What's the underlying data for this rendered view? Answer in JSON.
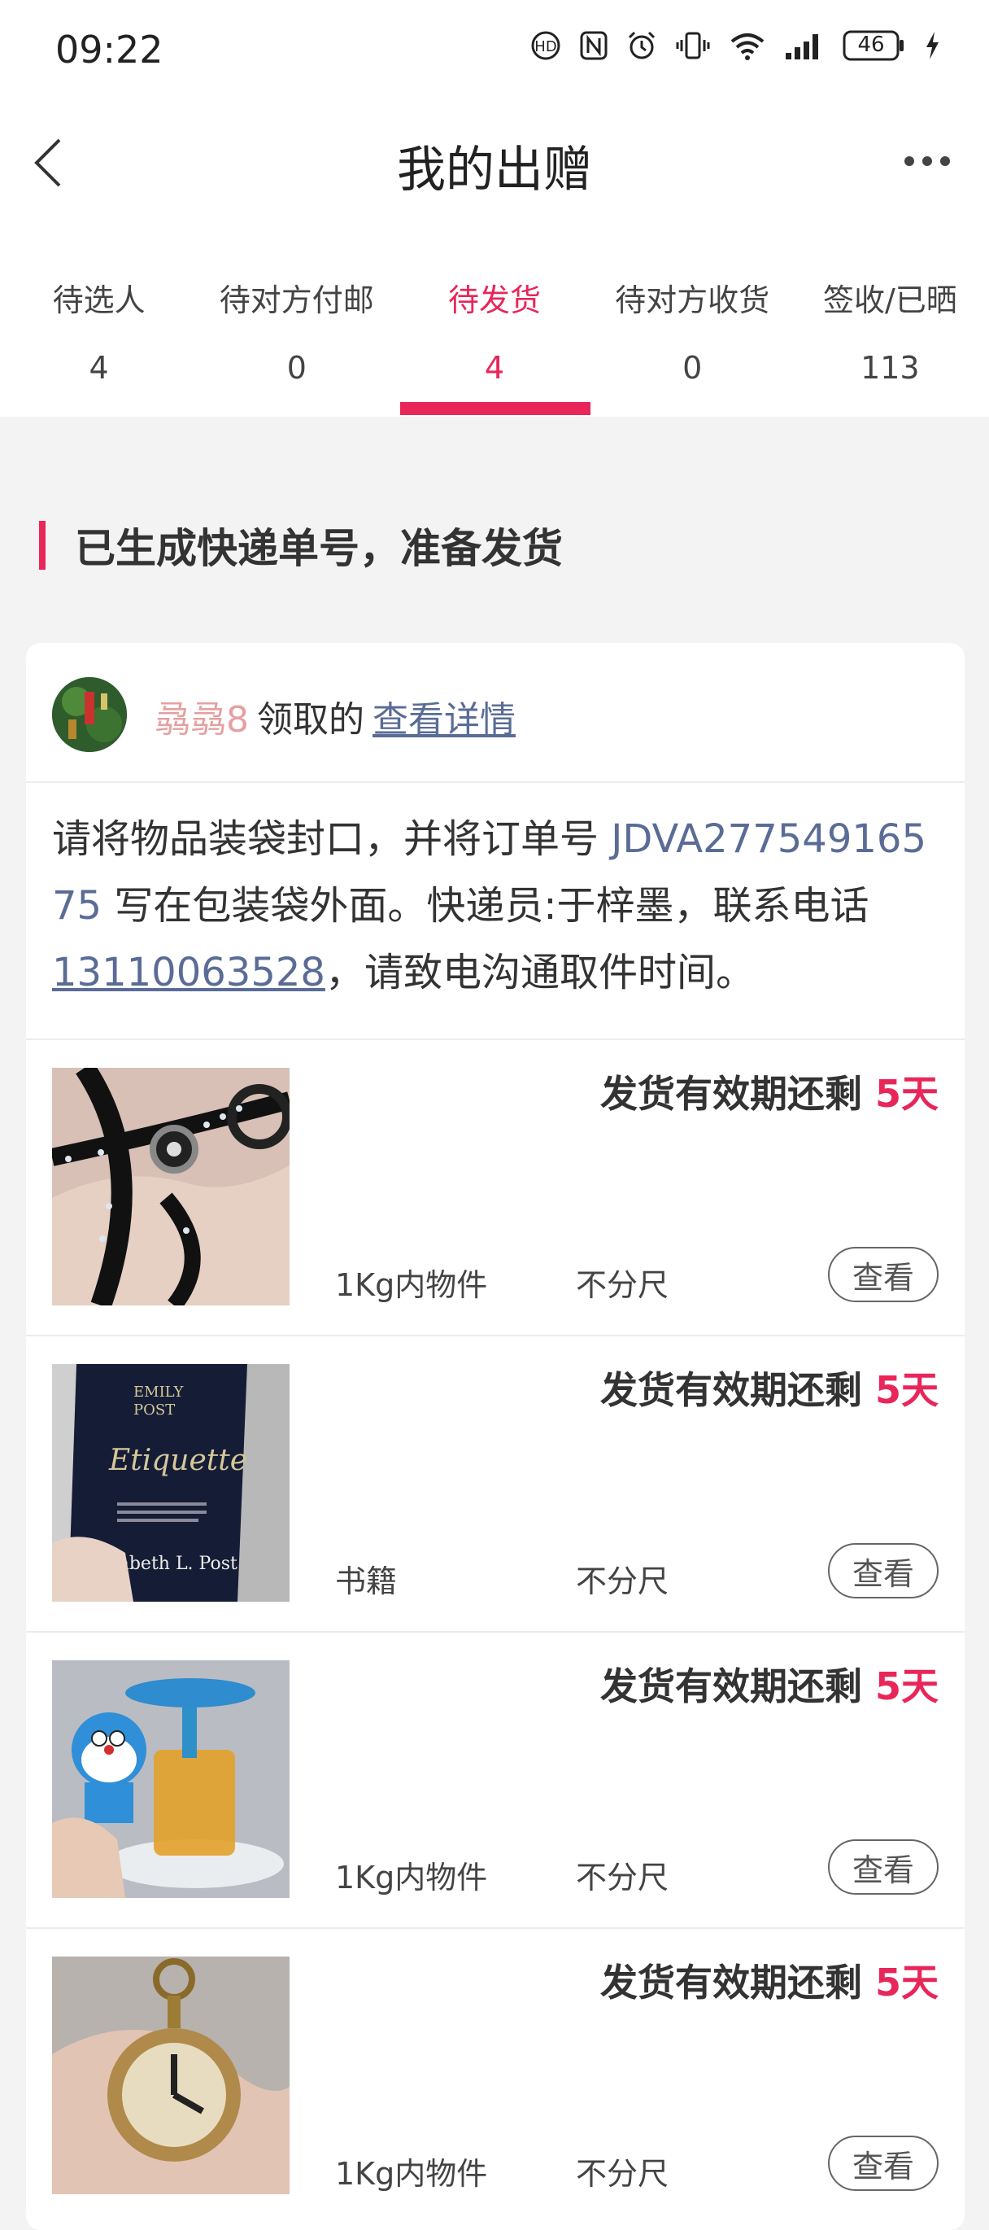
{
  "status_bar": {
    "time": "09:22",
    "battery": "46",
    "icons": [
      "wifi-calling-icon",
      "nfc-icon",
      "alarm-icon",
      "vibrate-icon",
      "wifi-icon",
      "signal-icon",
      "battery-icon",
      "charging-icon"
    ]
  },
  "nav": {
    "title": "我的出赠",
    "back_icon": "chevron-left-icon",
    "more_icon": "more-dots-icon"
  },
  "tabs": [
    {
      "label": "待选人",
      "count": "4",
      "active": false
    },
    {
      "label": "待对方付邮",
      "count": "0",
      "active": false
    },
    {
      "label": "待发货",
      "count": "4",
      "active": true
    },
    {
      "label": "待对方收货",
      "count": "0",
      "active": false
    },
    {
      "label": "签收/已晒",
      "count": "113",
      "active": false
    }
  ],
  "section": {
    "title": "已生成快递单号，准备发货"
  },
  "card": {
    "claimer": "骉骉8",
    "claim_text": "领取的",
    "detail_link": "查看详情",
    "instruction": {
      "part1": "请将物品装袋封口，并将订单号 ",
      "order_no": "JDVA27754916575",
      "part2": " 写在包装袋外面。快递员:于梓墨，联系电话",
      "phone": "13110063528",
      "part3": "，请致电沟通取件时间。"
    }
  },
  "items": [
    {
      "deadline_label": "发货有效期还剩",
      "days": "5天",
      "category": "1Kg内物件",
      "size": "不分尺",
      "button": "查看"
    },
    {
      "deadline_label": "发货有效期还剩",
      "days": "5天",
      "category": "书籍",
      "size": "不分尺",
      "button": "查看",
      "book_text": [
        "EMILY",
        "POST",
        "Etiquette",
        "Elizabeth L. Post"
      ]
    },
    {
      "deadline_label": "发货有效期还剩",
      "days": "5天",
      "category": "1Kg内物件",
      "size": "不分尺",
      "button": "查看"
    },
    {
      "deadline_label": "发货有效期还剩",
      "days": "5天",
      "category": "1Kg内物件",
      "size": "不分尺",
      "button": "查看"
    }
  ],
  "colors": {
    "accent": "#e8265a",
    "link": "#5a6c96",
    "claimer": "#e6a0a0"
  }
}
